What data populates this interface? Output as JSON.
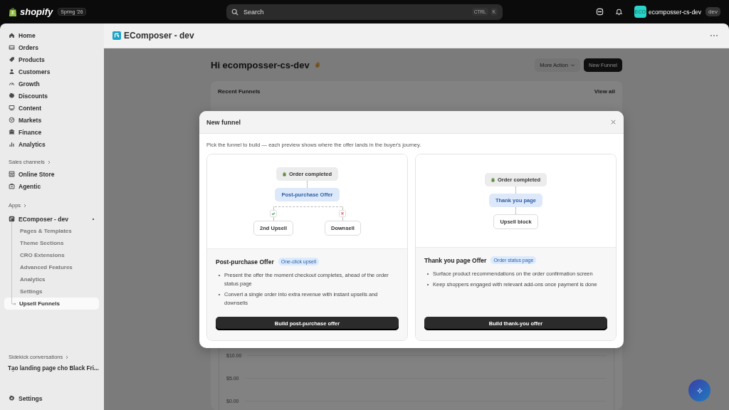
{
  "topbar": {
    "brand": "shopify",
    "edition": "Spring '26",
    "search": {
      "placeholder": "Search"
    },
    "shortcut": [
      "CTRL",
      "K"
    ],
    "avatar": "ECO",
    "store": "ecomposser-cs-dev",
    "store_badge": "dev"
  },
  "sidebar": {
    "items": [
      {
        "label": "Home",
        "selected": false
      },
      {
        "label": "Orders",
        "selected": false
      },
      {
        "label": "Products",
        "selected": false
      },
      {
        "label": "Customers",
        "selected": false
      },
      {
        "label": "Growth",
        "selected": false
      },
      {
        "label": "Discounts",
        "selected": false
      },
      {
        "label": "Content",
        "selected": false
      },
      {
        "label": "Markets",
        "selected": false
      },
      {
        "label": "Finance",
        "selected": false
      },
      {
        "label": "Analytics",
        "selected": false
      }
    ],
    "sales_channels": {
      "heading": "Sales channels",
      "items": [
        {
          "label": "Online Store",
          "selected": false
        },
        {
          "label": "Agentic",
          "selected": false
        }
      ]
    },
    "apps": {
      "heading": "Apps",
      "app": {
        "label": "EComposer - dev",
        "expanded": true,
        "children": [
          {
            "label": "Pages & Templates",
            "selected": false
          },
          {
            "label": "Theme Sections",
            "selected": false
          },
          {
            "label": "CRO Extensions",
            "selected": false
          },
          {
            "label": "Advanced Features",
            "selected": false
          },
          {
            "label": "Analytics",
            "selected": false
          },
          {
            "label": "Settings",
            "selected": false
          },
          {
            "label": "Upsell Funnels",
            "selected": true
          }
        ]
      }
    },
    "sidekick": {
      "heading": "Sidekick conversations",
      "items": [
        "Tạo landing page cho Black Fri..."
      ]
    },
    "settings": "Settings"
  },
  "app_header": {
    "title": "EComposer - dev"
  },
  "page": {
    "greeting": "Hi ecomposser-cs-dev",
    "actions": [
      {
        "label": "More Action",
        "kind": "menu"
      },
      {
        "label": "New Funnel",
        "kind": "primary"
      }
    ],
    "recent": {
      "title": "Recent Funnels",
      "link": "View all"
    },
    "axis_labels": [
      "$10.00",
      "$5.00",
      "$0.00"
    ]
  },
  "modal": {
    "title": "New funnel",
    "intro": "Pick the funnel to build — each preview shows where the offer lands in the buyer's journey.",
    "cards": [
      {
        "kind": "branch",
        "start": "Order completed",
        "offer": "Post-purchase Offer",
        "branches": [
          {
            "label": "2nd Upsell",
            "accepted": true
          },
          {
            "label": "Downsell",
            "accepted": false
          }
        ],
        "title": "Post-purchase Offer",
        "tag": "One-click upsell",
        "bullets": [
          "Present the offer the moment checkout completes, ahead of the order status page",
          "Convert a single order into extra revenue with instant upsells and downsells"
        ],
        "button": "Build post-purchase offer"
      },
      {
        "kind": "chain",
        "start": "Order completed",
        "offer": "Thank you page",
        "end": "Upsell block",
        "title": "Thank you page Offer",
        "tag": "Order status page",
        "bullets": [
          "Surface product recommendations on the order confirmation screen",
          "Keep shoppers engaged with relevant add-ons once payment is done"
        ],
        "button": "Build thank-you offer"
      }
    ]
  }
}
